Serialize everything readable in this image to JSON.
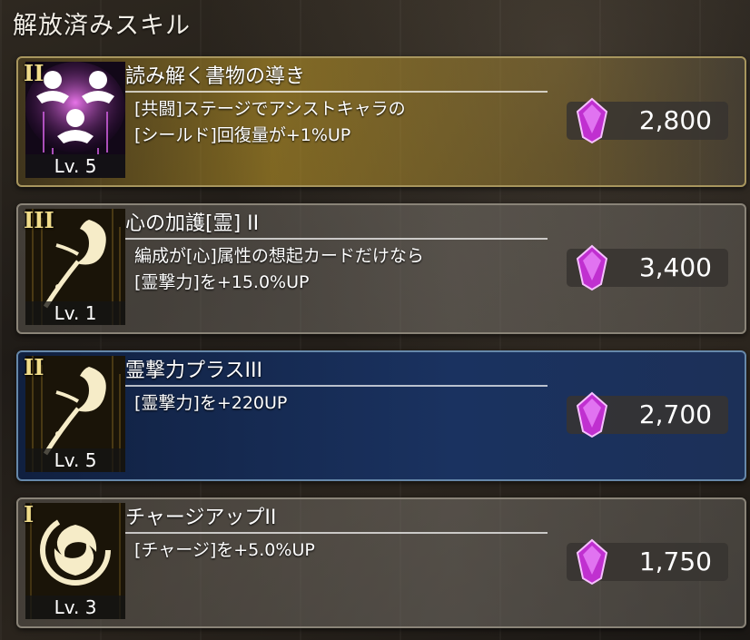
{
  "header": {
    "title": "解放済みスキル"
  },
  "skills": [
    {
      "rank": "II",
      "title": "読み解く書物の導き",
      "description": "[共闘]ステージでアシストキャラの\n[シールド]回復量が+1%UP",
      "level": "Lv. 5",
      "cost": "2,800",
      "icon": "three-figures-icon",
      "theme": "gold"
    },
    {
      "rank": "III",
      "title": "心の加護[霊] II",
      "description": "編成が[心]属性の想起カードだけなら\n[霊撃力]を+15.0%UP",
      "level": "Lv. 1",
      "cost": "3,400",
      "icon": "spirit-flame-icon",
      "theme": "grey"
    },
    {
      "rank": "II",
      "title": "霊撃力プラスIII",
      "description": "[霊撃力]を+220UP",
      "level": "Lv. 5",
      "cost": "2,700",
      "icon": "spirit-flame-icon",
      "theme": "blue"
    },
    {
      "rank": "I",
      "title": "チャージアップII",
      "description": "[チャージ]を+5.0%UP",
      "level": "Lv. 3",
      "cost": "1,750",
      "icon": "swirl-icon",
      "theme": "grey"
    }
  ],
  "colors": {
    "gem": "#d040e0",
    "gold_accent": "#f0dc8a"
  }
}
